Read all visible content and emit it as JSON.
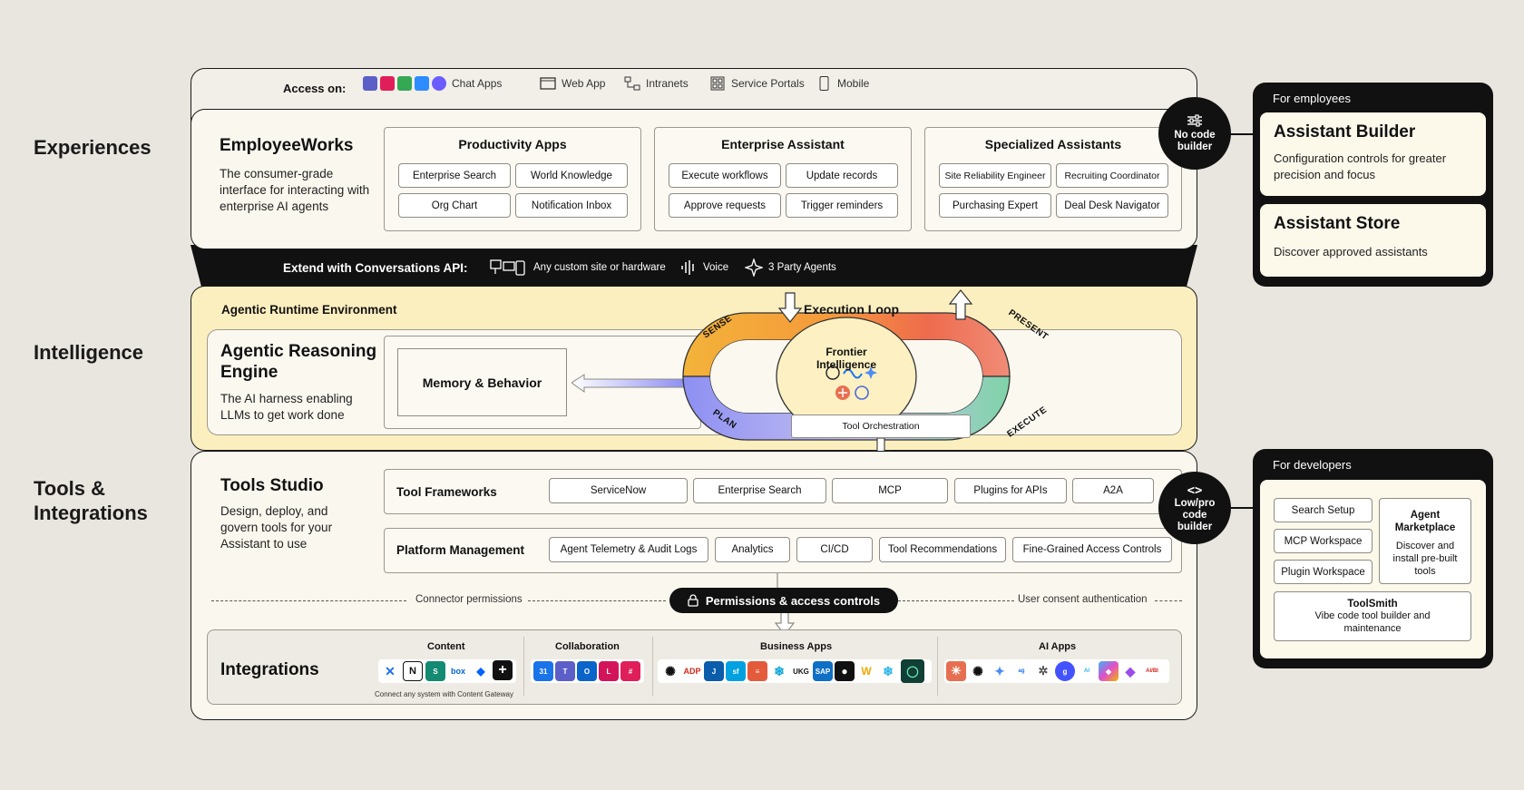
{
  "sections": {
    "experiences": "Experiences",
    "intelligence": "Intelligence",
    "tools": "Tools &",
    "tools2": "Integrations"
  },
  "access": {
    "label": "Access on:",
    "items": [
      "Chat Apps",
      "Web App",
      "Intranets",
      "Service Portals",
      "Mobile"
    ]
  },
  "employeeworks": {
    "title": "EmployeeWorks",
    "desc": "The consumer-grade interface for interacting with enterprise AI agents"
  },
  "productivity": {
    "title": "Productivity Apps",
    "items": [
      "Enterprise Search",
      "World Knowledge",
      "Org Chart",
      "Notification Inbox"
    ]
  },
  "enterprise_assistant": {
    "title": "Enterprise Assistant",
    "items": [
      "Execute workflows",
      "Update records",
      "Approve requests",
      "Trigger reminders"
    ]
  },
  "specialized": {
    "title": "Specialized Assistants",
    "items": [
      "Site Reliability Engineer",
      "Recruiting Coordinator",
      "Purchasing Expert",
      "Deal Desk Navigator"
    ]
  },
  "no_code_badge": "No code builder",
  "employees_panel": {
    "header": "For employees",
    "builder_title": "Assistant Builder",
    "builder_desc": "Configuration controls for greater precision and focus",
    "store_title": "Assistant Store",
    "store_desc": "Discover approved assistants"
  },
  "conversations_api": {
    "label": "Extend with Conversations API:",
    "items": [
      "Any custom site or hardware",
      "Voice",
      "3 Party Agents"
    ]
  },
  "runtime": {
    "title": "Agentic Runtime Environment",
    "engine_title": "Agentic Reasoning Engine",
    "engine_desc": "The AI harness enabling LLMs to get work done",
    "memory": "Memory & Behavior",
    "loop_title": "Execution Loop",
    "sense": "SENSE",
    "present": "PRESENT",
    "plan": "PLAN",
    "execute": "EXECUTE",
    "frontier": "Frontier Intelligence",
    "tool_orchestration": "Tool Orchestration"
  },
  "tools_studio": {
    "title": "Tools Studio",
    "desc": "Design, deploy, and govern tools for your Assistant to use",
    "frameworks_label": "Tool Frameworks",
    "frameworks": [
      "ServiceNow",
      "Enterprise Search",
      "MCP",
      "Plugins for APIs",
      "A2A"
    ],
    "platform_label": "Platform Management",
    "platform": [
      "Agent Telemetry & Audit Logs",
      "Analytics",
      "CI/CD",
      "Tool Recommendations",
      "Fine-Grained Access Controls"
    ]
  },
  "low_code_badge": "Low/pro code builder",
  "permissions": {
    "left": "Connector permissions",
    "center": "Permissions & access controls",
    "right": "User consent authentication"
  },
  "integrations": {
    "title": "Integrations",
    "content": "Content",
    "collaboration": "Collaboration",
    "business": "Business Apps",
    "ai": "AI Apps",
    "gateway_note": "Connect any system with Content Gateway"
  },
  "developers_panel": {
    "header": "For developers",
    "search_setup": "Search Setup",
    "mcp_workspace": "MCP Workspace",
    "plugin_workspace": "Plugin Workspace",
    "marketplace_title": "Agent Marketplace",
    "marketplace_desc": "Discover and install pre-built tools",
    "toolsmith_title": "ToolSmith",
    "toolsmith_desc": "Vibe code tool builder and maintenance"
  },
  "colors": {
    "background": "#e9e5df",
    "panel": "#faf7ee",
    "intelligence_panel": "#fcefbf",
    "dark": "#111111",
    "loop_sense": "#f3b33a",
    "loop_present": "#ee6b4d",
    "loop_plan": "#8d8ff2",
    "loop_execute": "#7fd3a8"
  }
}
